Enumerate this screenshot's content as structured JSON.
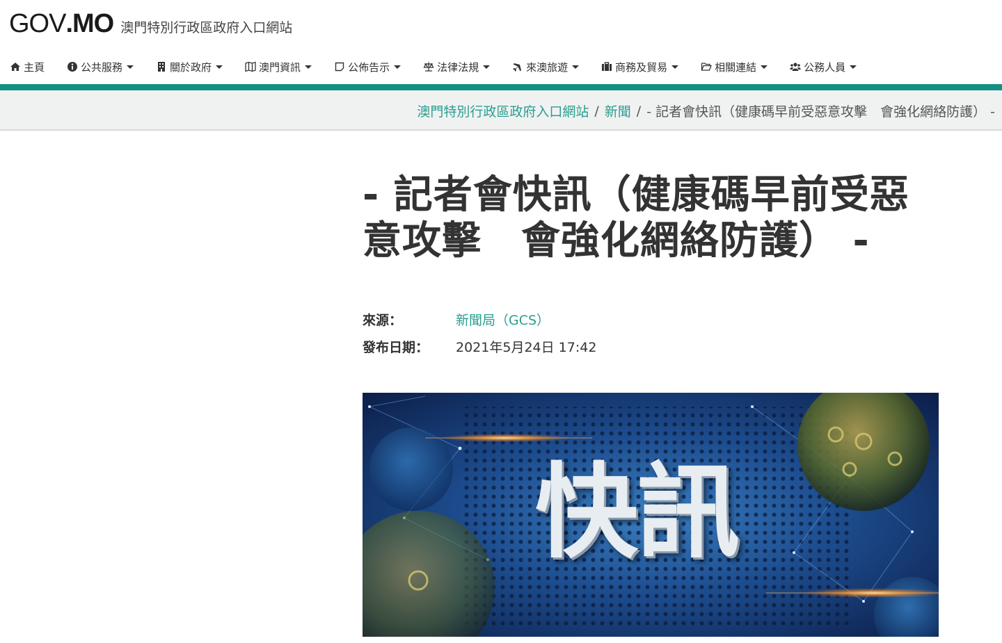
{
  "header": {
    "logo_gov": "GOV",
    "logo_dot": ".",
    "logo_mo": "MO",
    "site_name": "澳門特別行政區政府入口網站"
  },
  "nav": {
    "items": [
      {
        "label": "主頁",
        "icon": "home-icon",
        "has_caret": false
      },
      {
        "label": "公共服務",
        "icon": "info-circle-icon",
        "has_caret": true
      },
      {
        "label": "關於政府",
        "icon": "building-icon",
        "has_caret": true
      },
      {
        "label": "澳門資訊",
        "icon": "map-icon",
        "has_caret": true
      },
      {
        "label": "公佈告示",
        "icon": "sticky-note-icon",
        "has_caret": true
      },
      {
        "label": "法律法規",
        "icon": "balance-scale-icon",
        "has_caret": true
      },
      {
        "label": "來澳旅遊",
        "icon": "plane-icon",
        "has_caret": true
      },
      {
        "label": "商務及貿易",
        "icon": "briefcase-icon",
        "has_caret": true
      },
      {
        "label": "相關連結",
        "icon": "folder-open-icon",
        "has_caret": true
      },
      {
        "label": "公務人員",
        "icon": "users-icon",
        "has_caret": true
      }
    ]
  },
  "breadcrumb": {
    "home": "澳門特別行政區政府入口網站",
    "sep": "/",
    "news": "新聞",
    "current": "- 記者會快訊（健康碼早前受惡意攻擊　會強化網絡防護） -"
  },
  "article": {
    "title": "- 記者會快訊（健康碼早前受惡意攻擊　會強化網絡防護） -",
    "source_label": "來源：",
    "source_value": "新聞局（GCS）",
    "date_label": "發布日期：",
    "date_value": "2021年5月24日 17:42",
    "image_text": "快訊"
  },
  "colors": {
    "accent": "#149083",
    "link": "#2a9d8f",
    "breadcrumb_bg": "#f0f2f2"
  }
}
